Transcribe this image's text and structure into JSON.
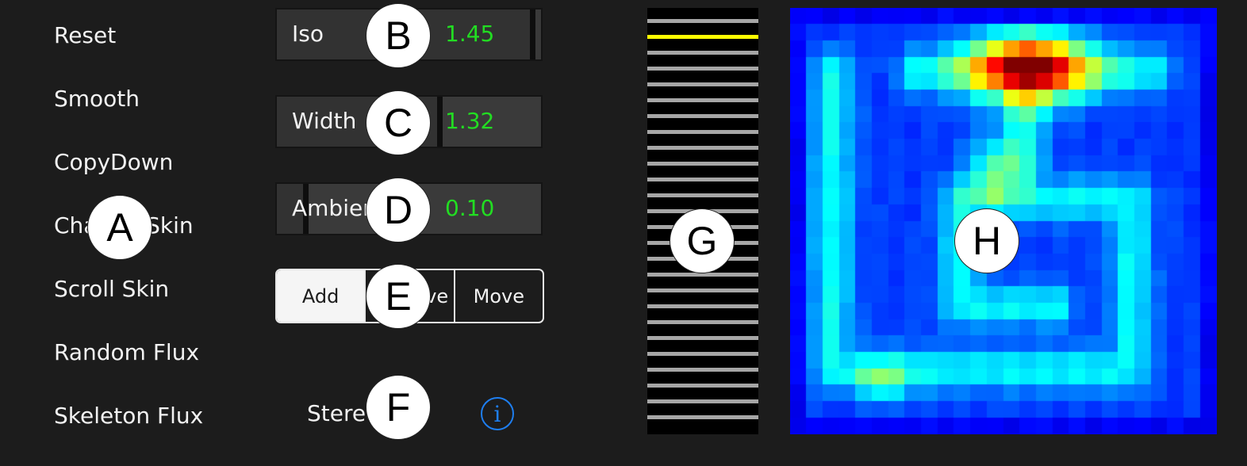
{
  "menu": [
    "Reset",
    "Smooth",
    "CopyDown",
    "Change Skin",
    "Scroll Skin",
    "Random Flux",
    "Skeleton Flux"
  ],
  "sliders": [
    {
      "label": "Iso",
      "value": "1.45",
      "position": 0.98
    },
    {
      "label": "Width",
      "value": "1.32",
      "position": 0.62
    },
    {
      "label": "Ambient",
      "value": "0.10",
      "position": 0.1
    }
  ],
  "segmented": {
    "options": [
      "Add",
      "Remove",
      "Move"
    ],
    "selected": "Add"
  },
  "stereo_label": "Stereo",
  "info_icon": "i",
  "list_panel": {
    "rows": 26,
    "selected_row": 1
  },
  "colors": {
    "value_text": "#22dd22",
    "info_blue": "#1e7ef0",
    "selected_line": "#ffff00",
    "line": "#a6a6a6"
  },
  "callouts": [
    "A",
    "B",
    "C",
    "D",
    "E",
    "F",
    "G",
    "H"
  ]
}
